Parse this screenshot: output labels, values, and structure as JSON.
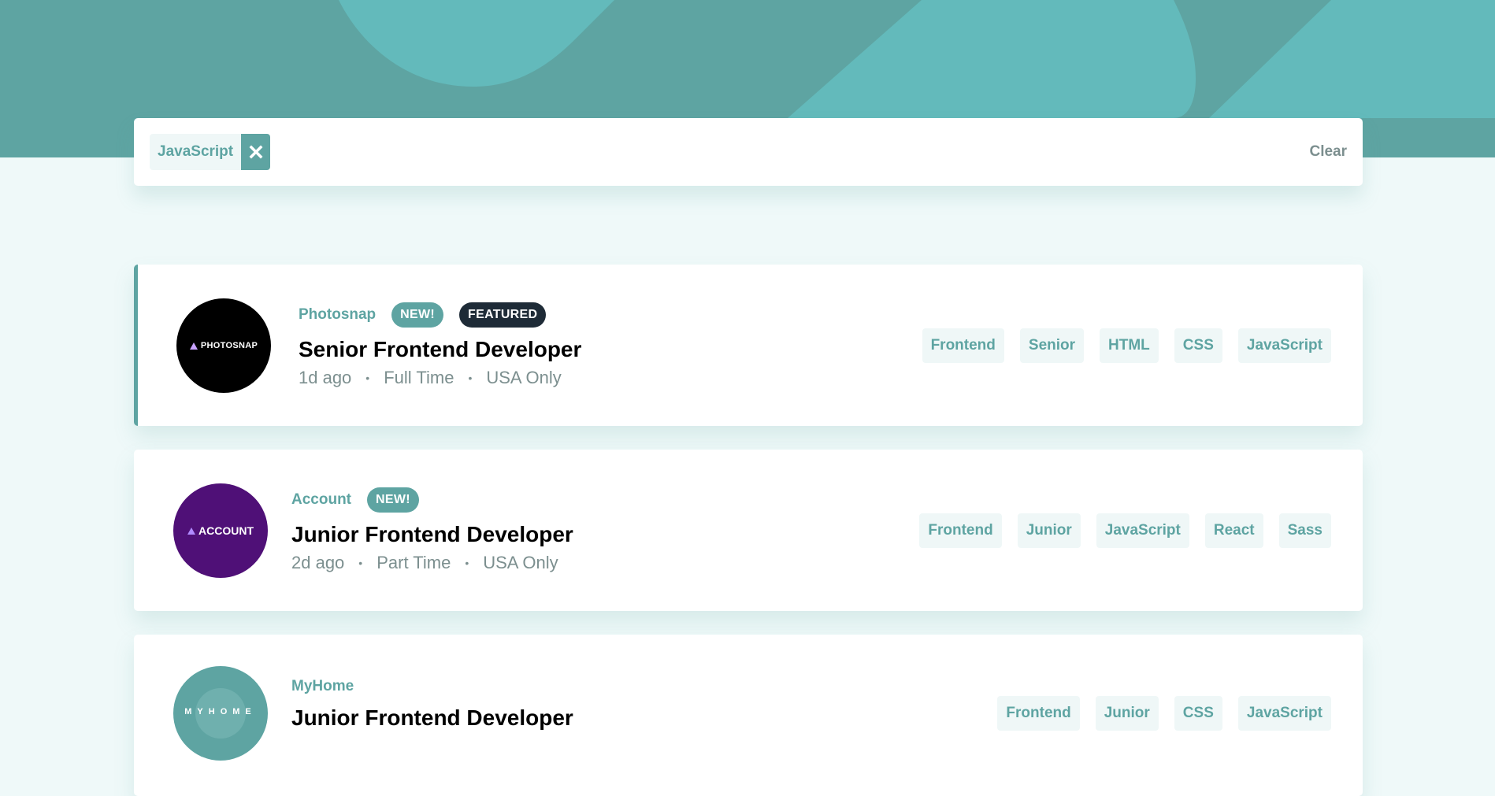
{
  "colors": {
    "primary": "#5ea4a2",
    "background": "#eff9f9",
    "dark_badge": "#1e2b37",
    "muted_text": "#7c8f8f",
    "account_logo": "#4f1077",
    "photosnap_logo": "#000000"
  },
  "filter": {
    "chips": [
      {
        "label": "JavaScript",
        "remove_icon": "close-icon"
      }
    ],
    "clear_label": "Clear"
  },
  "jobs": [
    {
      "company": "Photosnap",
      "logo_text": "PHOTOSNAP",
      "new_label": "NEW!",
      "featured_label": "FEATURED",
      "position": "Senior Frontend Developer",
      "posted": "1d ago",
      "contract": "Full Time",
      "location": "USA Only",
      "tags": [
        "Frontend",
        "Senior",
        "HTML",
        "CSS",
        "JavaScript"
      ]
    },
    {
      "company": "Account",
      "logo_text": "ACCOUNT",
      "new_label": "NEW!",
      "position": "Junior Frontend Developer",
      "posted": "2d ago",
      "contract": "Part Time",
      "location": "USA Only",
      "tags": [
        "Frontend",
        "Junior",
        "JavaScript",
        "React",
        "Sass"
      ]
    },
    {
      "company": "MyHome",
      "logo_text": "MYHOME",
      "position": "Junior Frontend Developer",
      "tags": [
        "Frontend",
        "Junior",
        "CSS",
        "JavaScript"
      ]
    }
  ]
}
